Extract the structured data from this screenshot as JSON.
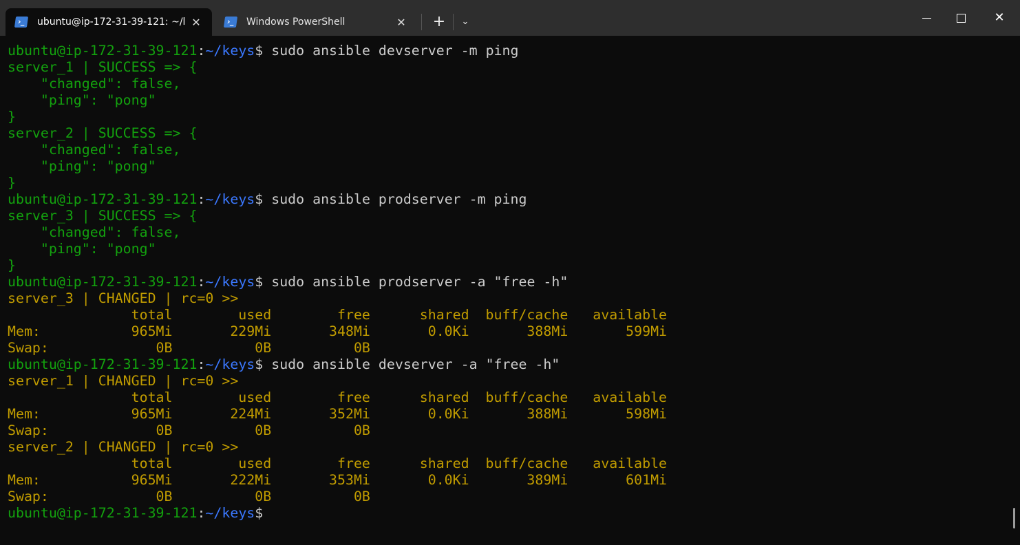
{
  "window": {
    "tabs": [
      {
        "label": "ubuntu@ip-172-31-39-121: ~/l",
        "icon": "powershell-icon",
        "active": true,
        "close": "✕"
      },
      {
        "label": "Windows PowerShell",
        "icon": "powershell-icon",
        "active": false,
        "close": "✕"
      }
    ],
    "new_tab": "+",
    "dropdown": "⌄",
    "close": "✕",
    "tab_icon_glyph": "›_"
  },
  "colors": {
    "background": "#0c0c0c",
    "green": "#13a10e",
    "blue": "#3b78ff",
    "yellow": "#c19c00",
    "white": "#cccccc"
  },
  "terminal": {
    "lines": [
      [
        [
          "ubuntu@ip-172-31-39-121",
          "g"
        ],
        [
          ":",
          "w"
        ],
        [
          "~/keys",
          "b"
        ],
        [
          "$ sudo ansible devserver -m ping",
          "w"
        ]
      ],
      [
        [
          "server_1 | SUCCESS => {",
          "g"
        ]
      ],
      [
        [
          "    \"changed\": false,",
          "g"
        ]
      ],
      [
        [
          "    \"ping\": \"pong\"",
          "g"
        ]
      ],
      [
        [
          "}",
          "g"
        ]
      ],
      [
        [
          "server_2 | SUCCESS => {",
          "g"
        ]
      ],
      [
        [
          "    \"changed\": false,",
          "g"
        ]
      ],
      [
        [
          "    \"ping\": \"pong\"",
          "g"
        ]
      ],
      [
        [
          "}",
          "g"
        ]
      ],
      [
        [
          "ubuntu@ip-172-31-39-121",
          "g"
        ],
        [
          ":",
          "w"
        ],
        [
          "~/keys",
          "b"
        ],
        [
          "$ sudo ansible prodserver -m ping",
          "w"
        ]
      ],
      [
        [
          "server_3 | SUCCESS => {",
          "g"
        ]
      ],
      [
        [
          "    \"changed\": false,",
          "g"
        ]
      ],
      [
        [
          "    \"ping\": \"pong\"",
          "g"
        ]
      ],
      [
        [
          "}",
          "g"
        ]
      ],
      [
        [
          "ubuntu@ip-172-31-39-121",
          "g"
        ],
        [
          ":",
          "w"
        ],
        [
          "~/keys",
          "b"
        ],
        [
          "$ sudo ansible prodserver -a \"free -h\"",
          "w"
        ]
      ],
      [
        [
          "server_3 | CHANGED | rc=0 >>",
          "y"
        ]
      ],
      [
        [
          "               total        used        free      shared  buff/cache   available",
          "y"
        ]
      ],
      [
        [
          "Mem:           965Mi       229Mi       348Mi       0.0Ki       388Mi       599Mi",
          "y"
        ]
      ],
      [
        [
          "Swap:             0B          0B          0B",
          "y"
        ]
      ],
      [
        [
          "ubuntu@ip-172-31-39-121",
          "g"
        ],
        [
          ":",
          "w"
        ],
        [
          "~/keys",
          "b"
        ],
        [
          "$ sudo ansible devserver -a \"free -h\"",
          "w"
        ]
      ],
      [
        [
          "server_1 | CHANGED | rc=0 >>",
          "y"
        ]
      ],
      [
        [
          "               total        used        free      shared  buff/cache   available",
          "y"
        ]
      ],
      [
        [
          "Mem:           965Mi       224Mi       352Mi       0.0Ki       388Mi       598Mi",
          "y"
        ]
      ],
      [
        [
          "Swap:             0B          0B          0B",
          "y"
        ]
      ],
      [
        [
          "server_2 | CHANGED | rc=0 >>",
          "y"
        ]
      ],
      [
        [
          "               total        used        free      shared  buff/cache   available",
          "y"
        ]
      ],
      [
        [
          "Mem:           965Mi       222Mi       353Mi       0.0Ki       389Mi       601Mi",
          "y"
        ]
      ],
      [
        [
          "Swap:             0B          0B          0B",
          "y"
        ]
      ],
      [
        [
          "ubuntu@ip-172-31-39-121",
          "g"
        ],
        [
          ":",
          "w"
        ],
        [
          "~/keys",
          "b"
        ],
        [
          "$",
          "w"
        ]
      ]
    ]
  }
}
